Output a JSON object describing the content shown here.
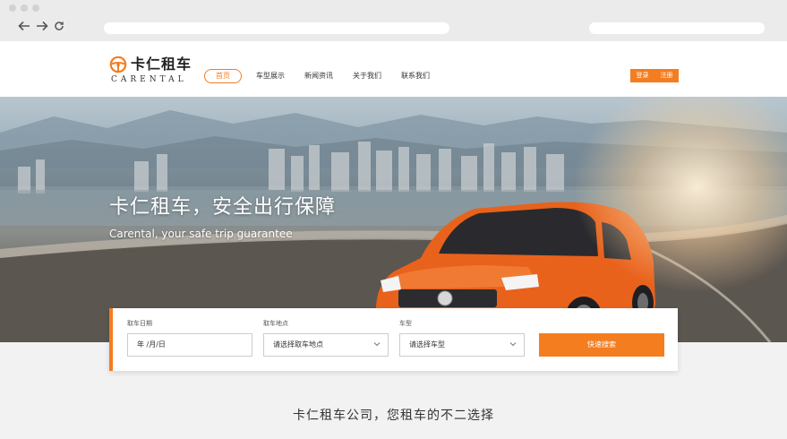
{
  "brand": {
    "name_cn": "卡仁租车",
    "name_en": "CARENTAL",
    "accent_color": "#f47d20"
  },
  "browser": {
    "back_icon": "arrow-left-icon",
    "forward_icon": "arrow-right-icon",
    "reload_icon": "reload-icon"
  },
  "nav": {
    "items": [
      {
        "label": "首页",
        "active": true
      },
      {
        "label": "车型展示",
        "active": false
      },
      {
        "label": "新闻资讯",
        "active": false
      },
      {
        "label": "关于我们",
        "active": false
      },
      {
        "label": "联系我们",
        "active": false
      }
    ],
    "login_label": "登录",
    "register_label": "注册"
  },
  "hero": {
    "title": "卡仁租车，安全出行保障",
    "subtitle": "Carental, your safe trip guarantee"
  },
  "search": {
    "date": {
      "label": "取车日期",
      "value": "年 /月/日"
    },
    "location": {
      "label": "取车地点",
      "placeholder": "请选择取车地点"
    },
    "car_type": {
      "label": "车型",
      "placeholder": "请选择车型"
    },
    "submit_label": "快速搜索"
  },
  "tagline": "卡仁租车公司，您租车的不二选择"
}
